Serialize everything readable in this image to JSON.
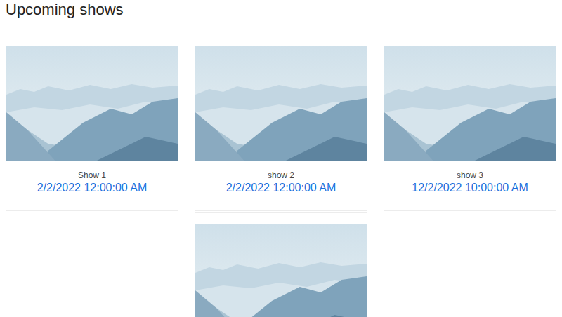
{
  "page": {
    "title": "Upcoming shows"
  },
  "shows": [
    {
      "title": "Show 1",
      "date": "2/2/2022 12:00:00 AM"
    },
    {
      "title": "show 2",
      "date": "2/2/2022 12:00:00 AM"
    },
    {
      "title": "show 3",
      "date": "12/2/2022 10:00:00 AM"
    },
    {}
  ]
}
